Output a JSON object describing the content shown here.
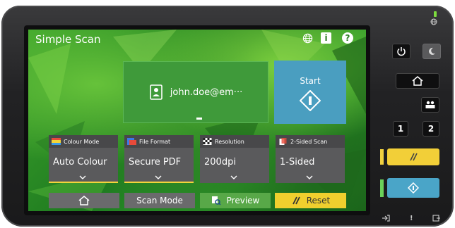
{
  "screen": {
    "title": "Simple Scan",
    "top_icons": [
      "globe-icon",
      "info-icon",
      "help-icon"
    ],
    "info_glyph": "i",
    "help_glyph": "?"
  },
  "destination": {
    "text": "john.doe@em···",
    "icon": "contact-card-icon"
  },
  "start": {
    "label": "Start",
    "icon": "start-diamond-icon"
  },
  "settings": [
    {
      "label": "Colour Mode",
      "value": "Auto Colour",
      "icon": "colour-mode-icon"
    },
    {
      "label": "File Format",
      "value": "Secure PDF",
      "icon": "pdf-icon"
    },
    {
      "label": "Resolution",
      "value": "200dpi",
      "icon": "resolution-icon"
    },
    {
      "label": "2-Sided Scan",
      "value": "1-Sided",
      "icon": "duplex-icon"
    }
  ],
  "bottom_bar": {
    "home_icon": "home-icon",
    "scan_mode": "Scan Mode",
    "preview": "Preview",
    "reset": "Reset"
  },
  "hardware": {
    "key_1": "1",
    "key_2": "2",
    "foot_icons": [
      "login-icon",
      "alert-icon",
      "data-icon"
    ],
    "alert_glyph": "!"
  },
  "colors": {
    "screen_green": "#2c9a2a",
    "start_blue": "#4a9ec0",
    "reset_yellow": "#f0cf2e",
    "accent_yellow": "#f2d43a"
  }
}
